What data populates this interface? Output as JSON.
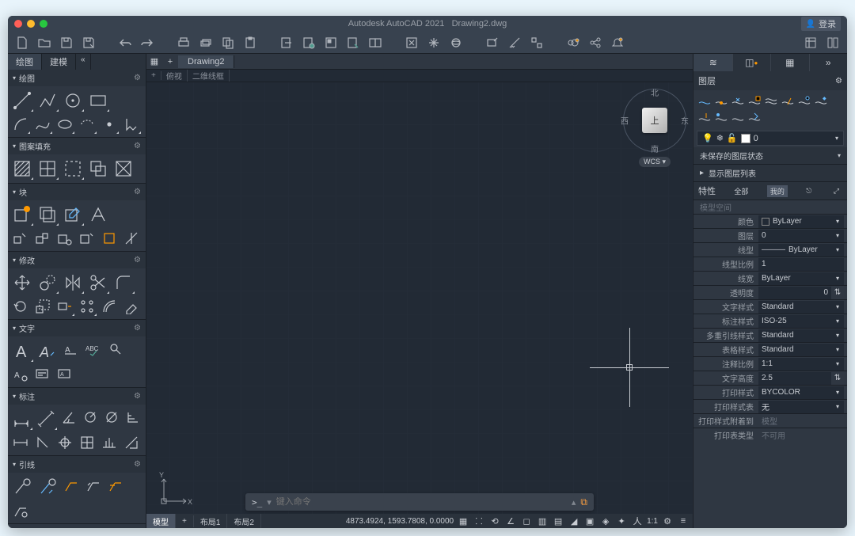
{
  "title": {
    "app": "Autodesk AutoCAD 2021",
    "file": "Drawing2.dwg"
  },
  "login_label": "登录",
  "left_tabs": {
    "draw": "绘图",
    "model": "建模"
  },
  "sections": {
    "draw": "绘图",
    "hatch": "图案填充",
    "block": "块",
    "modify": "修改",
    "text": "文字",
    "dim": "标注",
    "leader": "引线"
  },
  "file_tab": "Drawing2",
  "view_tabs": {
    "top": "俯视",
    "wireframe": "二维线框"
  },
  "viewcube": {
    "top": "上",
    "n": "北",
    "s": "南",
    "e": "东",
    "w": "西",
    "wcs": "WCS"
  },
  "command_placeholder": "键入命令",
  "layout_tabs": {
    "model": "模型",
    "layout1": "布局1",
    "layout2": "布局2"
  },
  "coords": "4873.4924, 1593.7808, 0.0000",
  "status_ratio": "1:1",
  "right_panel": {
    "layers_title": "图层",
    "layer_current": "0",
    "unsaved_state": "未保存的图层状态",
    "show_list": "显示图层列表",
    "props_title": "特性",
    "all": "全部",
    "mine": "我的",
    "selection": "模型空间",
    "props": {
      "color_lbl": "颜色",
      "color_val": "ByLayer",
      "layer_lbl": "图层",
      "layer_val": "0",
      "linetype_lbl": "线型",
      "linetype_val": "ByLayer",
      "ltscale_lbl": "线型比例",
      "ltscale_val": "1",
      "lineweight_lbl": "线宽",
      "lineweight_val": "ByLayer",
      "transp_lbl": "透明度",
      "transp_val": "0",
      "textstyle_lbl": "文字样式",
      "textstyle_val": "Standard",
      "dimstyle_lbl": "标注样式",
      "dimstyle_val": "ISO-25",
      "mleader_lbl": "多重引线样式",
      "mleader_val": "Standard",
      "tablestyle_lbl": "表格样式",
      "tablestyle_val": "Standard",
      "annoscale_lbl": "注释比例",
      "annoscale_val": "1:1",
      "textheight_lbl": "文字高度",
      "textheight_val": "2.5",
      "plotstyle_lbl": "打印样式",
      "plotstyle_val": "BYCOLOR",
      "plottable_lbl": "打印样式表",
      "plottable_val": "无",
      "plotattach_lbl": "打印样式附着到",
      "plotattach_val": "模型",
      "plottype_lbl": "打印表类型",
      "plottype_val": "不可用"
    }
  }
}
